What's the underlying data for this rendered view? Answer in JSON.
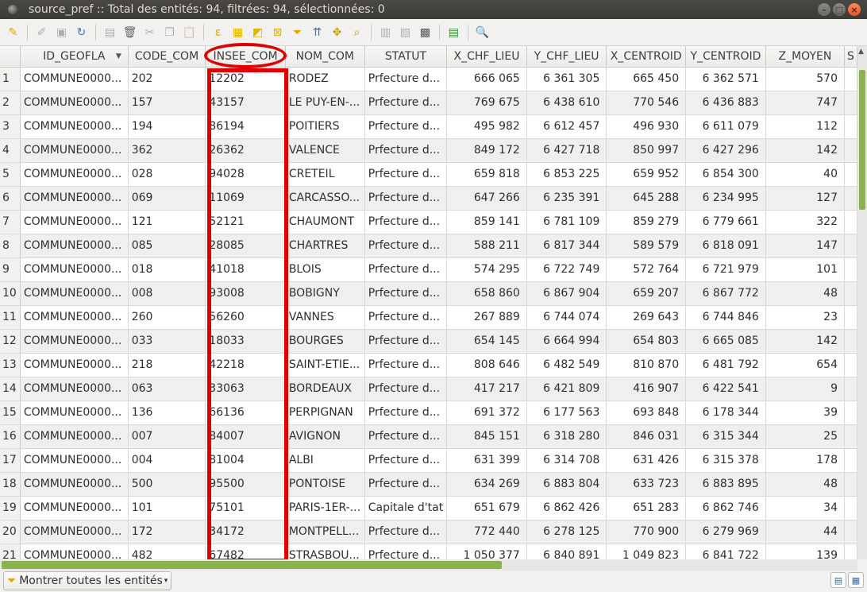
{
  "window": {
    "title": "source_pref :: Total des entités: 94, filtrées: 94, sélectionnées: 0"
  },
  "columns": [
    "ID_GEOFLA",
    "CODE_COM",
    "INSEE_COM",
    "NOM_COM",
    "STATUT",
    "X_CHF_LIEU",
    "Y_CHF_LIEU",
    "X_CENTROID",
    "Y_CENTROID",
    "Z_MOYEN",
    "S"
  ],
  "rows": [
    [
      "1",
      "COMMUNE0000...",
      "202",
      "12202",
      "RODEZ",
      "Prfecture d...",
      "666 065",
      "6 361 305",
      "665 450",
      "6 362 571",
      "570"
    ],
    [
      "2",
      "COMMUNE0000...",
      "157",
      "43157",
      "LE PUY-EN-...",
      "Prfecture d...",
      "769 675",
      "6 438 610",
      "770 546",
      "6 436 883",
      "747"
    ],
    [
      "3",
      "COMMUNE0000...",
      "194",
      "86194",
      "POITIERS",
      "Prfecture d...",
      "495 982",
      "6 612 457",
      "496 930",
      "6 611 079",
      "112"
    ],
    [
      "4",
      "COMMUNE0000...",
      "362",
      "26362",
      "VALENCE",
      "Prfecture d...",
      "849 172",
      "6 427 718",
      "850 997",
      "6 427 296",
      "142"
    ],
    [
      "5",
      "COMMUNE0000...",
      "028",
      "94028",
      "CRETEIL",
      "Prfecture d...",
      "659 818",
      "6 853 225",
      "659 952",
      "6 854 300",
      "40"
    ],
    [
      "6",
      "COMMUNE0000...",
      "069",
      "11069",
      "CARCASSO...",
      "Prfecture d...",
      "647 266",
      "6 235 391",
      "645 288",
      "6 234 995",
      "127"
    ],
    [
      "7",
      "COMMUNE0000...",
      "121",
      "52121",
      "CHAUMONT",
      "Prfecture d...",
      "859 141",
      "6 781 109",
      "859 279",
      "6 779 661",
      "322"
    ],
    [
      "8",
      "COMMUNE0000...",
      "085",
      "28085",
      "CHARTRES",
      "Prfecture d...",
      "588 211",
      "6 817 344",
      "589 579",
      "6 818 091",
      "147"
    ],
    [
      "9",
      "COMMUNE0000...",
      "018",
      "41018",
      "BLOIS",
      "Prfecture d...",
      "574 295",
      "6 722 749",
      "572 764",
      "6 721 979",
      "101"
    ],
    [
      "10",
      "COMMUNE0000...",
      "008",
      "93008",
      "BOBIGNY",
      "Prfecture d...",
      "658 860",
      "6 867 904",
      "659 207",
      "6 867 772",
      "48"
    ],
    [
      "11",
      "COMMUNE0000...",
      "260",
      "56260",
      "VANNES",
      "Prfecture d...",
      "267 889",
      "6 744 074",
      "269 643",
      "6 744 846",
      "23"
    ],
    [
      "12",
      "COMMUNE0000...",
      "033",
      "18033",
      "BOURGES",
      "Prfecture d...",
      "654 145",
      "6 664 994",
      "654 803",
      "6 665 085",
      "142"
    ],
    [
      "13",
      "COMMUNE0000...",
      "218",
      "42218",
      "SAINT-ETIE...",
      "Prfecture d...",
      "808 646",
      "6 482 549",
      "810 870",
      "6 481 792",
      "654"
    ],
    [
      "14",
      "COMMUNE0000...",
      "063",
      "33063",
      "BORDEAUX",
      "Prfecture d...",
      "417 217",
      "6 421 809",
      "416 907",
      "6 422 541",
      "9"
    ],
    [
      "15",
      "COMMUNE0000...",
      "136",
      "66136",
      "PERPIGNAN",
      "Prfecture d...",
      "691 372",
      "6 177 563",
      "693 848",
      "6 178 344",
      "39"
    ],
    [
      "16",
      "COMMUNE0000...",
      "007",
      "84007",
      "AVIGNON",
      "Prfecture d...",
      "845 151",
      "6 318 280",
      "846 031",
      "6 315 344",
      "25"
    ],
    [
      "17",
      "COMMUNE0000...",
      "004",
      "81004",
      "ALBI",
      "Prfecture d...",
      "631 399",
      "6 314 708",
      "631 426",
      "6 315 378",
      "178"
    ],
    [
      "18",
      "COMMUNE0000...",
      "500",
      "95500",
      "PONTOISE",
      "Prfecture d...",
      "634 269",
      "6 883 804",
      "633 723",
      "6 883 895",
      "48"
    ],
    [
      "19",
      "COMMUNE0000...",
      "101",
      "75101",
      "PARIS-1ER-...",
      "Capitale d'tat",
      "651 679",
      "6 862 426",
      "651 283",
      "6 862 746",
      "34"
    ],
    [
      "20",
      "COMMUNE0000...",
      "172",
      "34172",
      "MONTPELL...",
      "Prfecture d...",
      "772 440",
      "6 278 125",
      "770 900",
      "6 279 969",
      "44"
    ],
    [
      "21",
      "COMMUNE0000...",
      "482",
      "67482",
      "STRASBOU...",
      "Prfecture d...",
      "1 050 377",
      "6 840 891",
      "1 049 823",
      "6 841 722",
      "139"
    ]
  ],
  "bottombar": {
    "show_all_label": "Montrer toutes les entités"
  },
  "colors": {
    "highlight": "#e00000",
    "scrollbar_thumb": "#8ab34f"
  }
}
